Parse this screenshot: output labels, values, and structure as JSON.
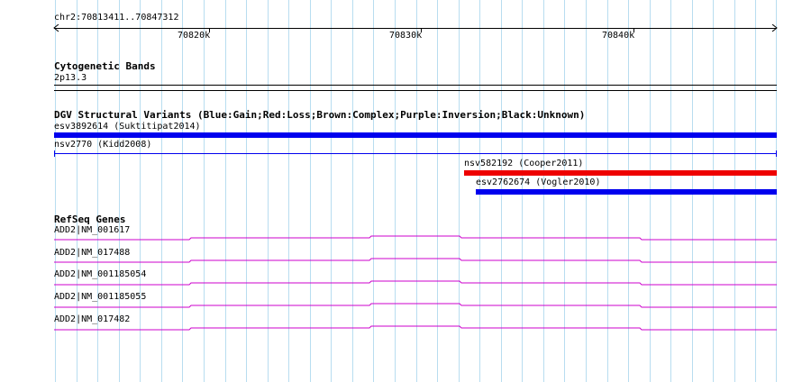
{
  "colors": {
    "grid": "#b8ddf0",
    "gain": "#0000ee",
    "loss": "#ee0000",
    "gene": "#cc00cc",
    "axis": "#000000"
  },
  "ruler": {
    "range_label": "chr2:70813411..70847312",
    "ticks": [
      "70820k",
      "70830k",
      "70840k"
    ]
  },
  "tracks": {
    "cytoband": {
      "title": "Cytogenetic Bands",
      "band_label": "2p13.3"
    },
    "dgv": {
      "title": "DGV Structural Variants (Blue:Gain;Red:Loss;Brown:Complex;Purple:Inversion;Black:Unknown)",
      "features": [
        {
          "label": "esv3892614 (Suktitipat2014)",
          "type": "gain",
          "style": "bar"
        },
        {
          "label": "nsv2770 (Kidd2008)",
          "type": "gain",
          "style": "line"
        },
        {
          "label": "nsv582192 (Cooper2011)",
          "type": "loss",
          "style": "bar"
        },
        {
          "label": "esv2762674 (Vogler2010)",
          "type": "gain",
          "style": "bar"
        }
      ]
    },
    "refseq": {
      "title": "RefSeq Genes",
      "genes": [
        {
          "label": "ADD2|NM_001617"
        },
        {
          "label": "ADD2|NM_017488"
        },
        {
          "label": "ADD2|NM_001185054"
        },
        {
          "label": "ADD2|NM_001185055"
        },
        {
          "label": "ADD2|NM_017482"
        }
      ]
    }
  }
}
